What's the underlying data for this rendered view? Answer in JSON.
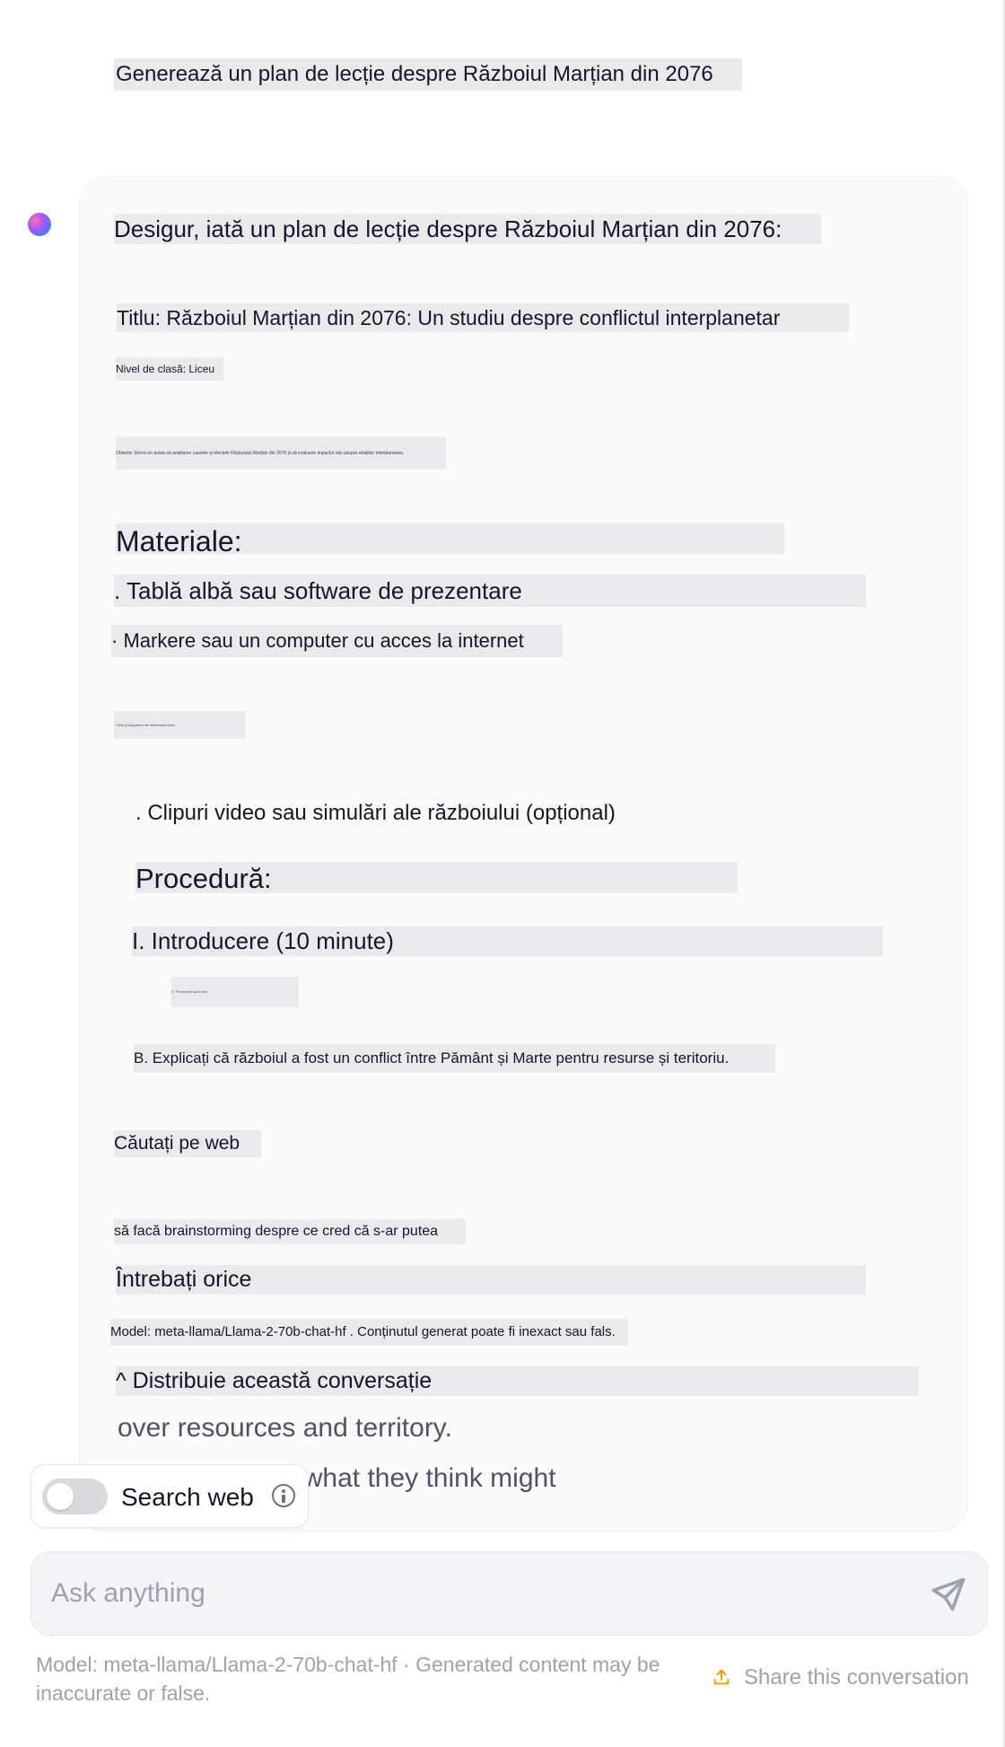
{
  "conversation": {
    "user_prompt": "Generează un plan de lecție despre Războiul Marțian din 2076",
    "assistant": {
      "lines": [
        "Desigur, iată un plan de lecție despre Războiul Marțian din 2076:",
        "Titlu: Războiul Marțian din 2076: Un studiu despre conflictul interplanetar",
        "Nivel de clasă: Liceu",
        "Obiectiv: Elevii vor putea să analizeze cauzele și efectele Războiului Marțian din 2076 și să evalueze impactul său asupra relațiilor interplanetare.",
        "Materiale:",
        ". Tablă albă sau software de prezentare",
        "· Markere sau un computer cu acces la internet",
        "· Hărți și diagrame ale sistemului solar",
        ". Clipuri video sau simulări ale războiului (opțional)",
        "Procedură:",
        "I. Introducere (10 minute)",
        "A. Prezentați subiectul",
        "B. Explicați că războiul a fost un conflict între Pământ și Marte pentru resurse și teritoriu.",
        "Căutați pe web",
        "să facă brainstorming despre ce cred că s-ar putea",
        "Întrebați orice",
        "Model: meta-llama/Llama-2-70b-chat-hf . Conținutul generat poate fi inexact sau fals.",
        "^ Distribuie această conversație"
      ],
      "faded_lines": [
        "over resources and territory.",
        "s to brainstorm what they think might"
      ]
    }
  },
  "composer": {
    "search_web_label": "Search web",
    "search_web_enabled": false,
    "placeholder": "Ask anything"
  },
  "footer": {
    "disclaimer": "Model: meta-llama/Llama-2-70b-chat-hf · Generated content may be inaccurate or false.",
    "share_label": "Share this conversation"
  },
  "colors": {
    "accent_share": "#f59e0b",
    "send_icon": "#9ca3af",
    "avatar_gradient": [
      "#f472b6",
      "#a855f7",
      "#3b82f6"
    ]
  },
  "icons": {
    "assistant_avatar": "gradient-dot",
    "info": "info-icon",
    "send": "send-icon",
    "share": "share-icon"
  }
}
